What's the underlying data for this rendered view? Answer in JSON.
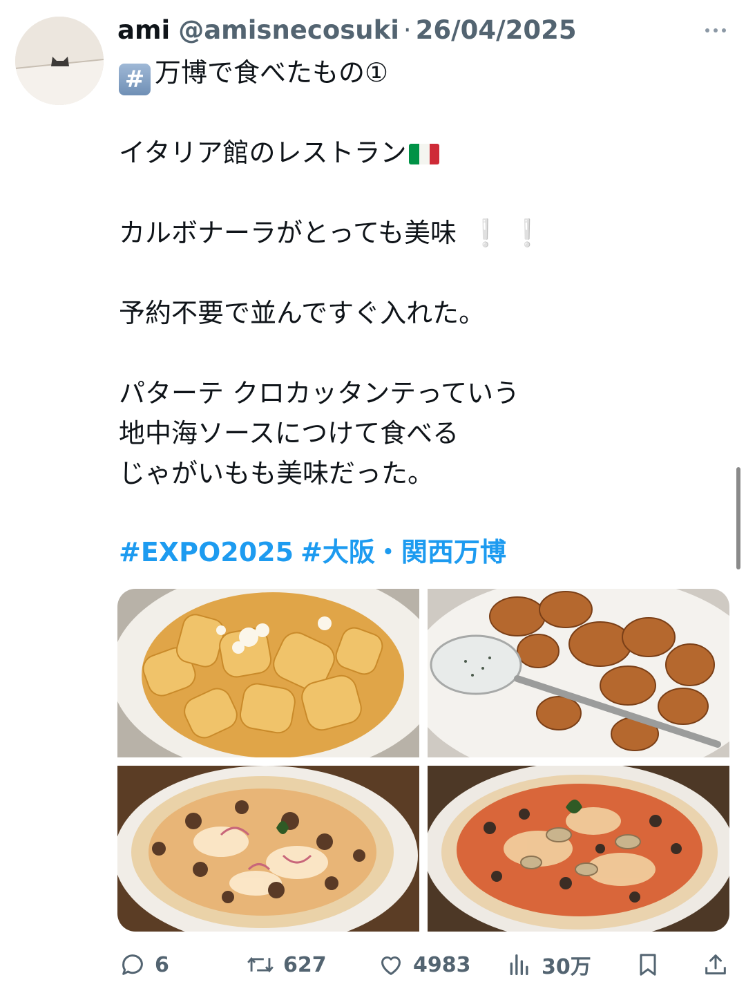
{
  "tweet": {
    "author_name": "ami",
    "author_handle": "@amisnecosuki",
    "separator": "·",
    "date": "26/04/2025",
    "text": {
      "line1_badge": "#",
      "line1": "万博で食べたもの①",
      "line2": "イタリア館のレストラン",
      "line3": "カルボナーラがとっても美味",
      "line3_marks": "❕ ❕",
      "line4": "予約不要で並んですぐ入れた。",
      "line5": "パターテ クロカッタンテっていう",
      "line6": "地中海ソースにつけて食べる",
      "line7": "じゃがいもも美味だった。"
    },
    "hashtags": [
      "#EXPO2025",
      "#大阪・関西万博"
    ],
    "media": [
      {
        "icon": "rigatoni-carbonara-photo"
      },
      {
        "icon": "roast-potatoes-with-sauce-photo"
      },
      {
        "icon": "sausage-pizza-photo"
      },
      {
        "icon": "mushroom-pizza-photo"
      }
    ],
    "stats": {
      "replies": "6",
      "reposts": "627",
      "likes": "4983",
      "views": "30万"
    }
  },
  "colors": {
    "text": "#0f1419",
    "secondary": "#536471",
    "link": "#1d9bf0"
  }
}
